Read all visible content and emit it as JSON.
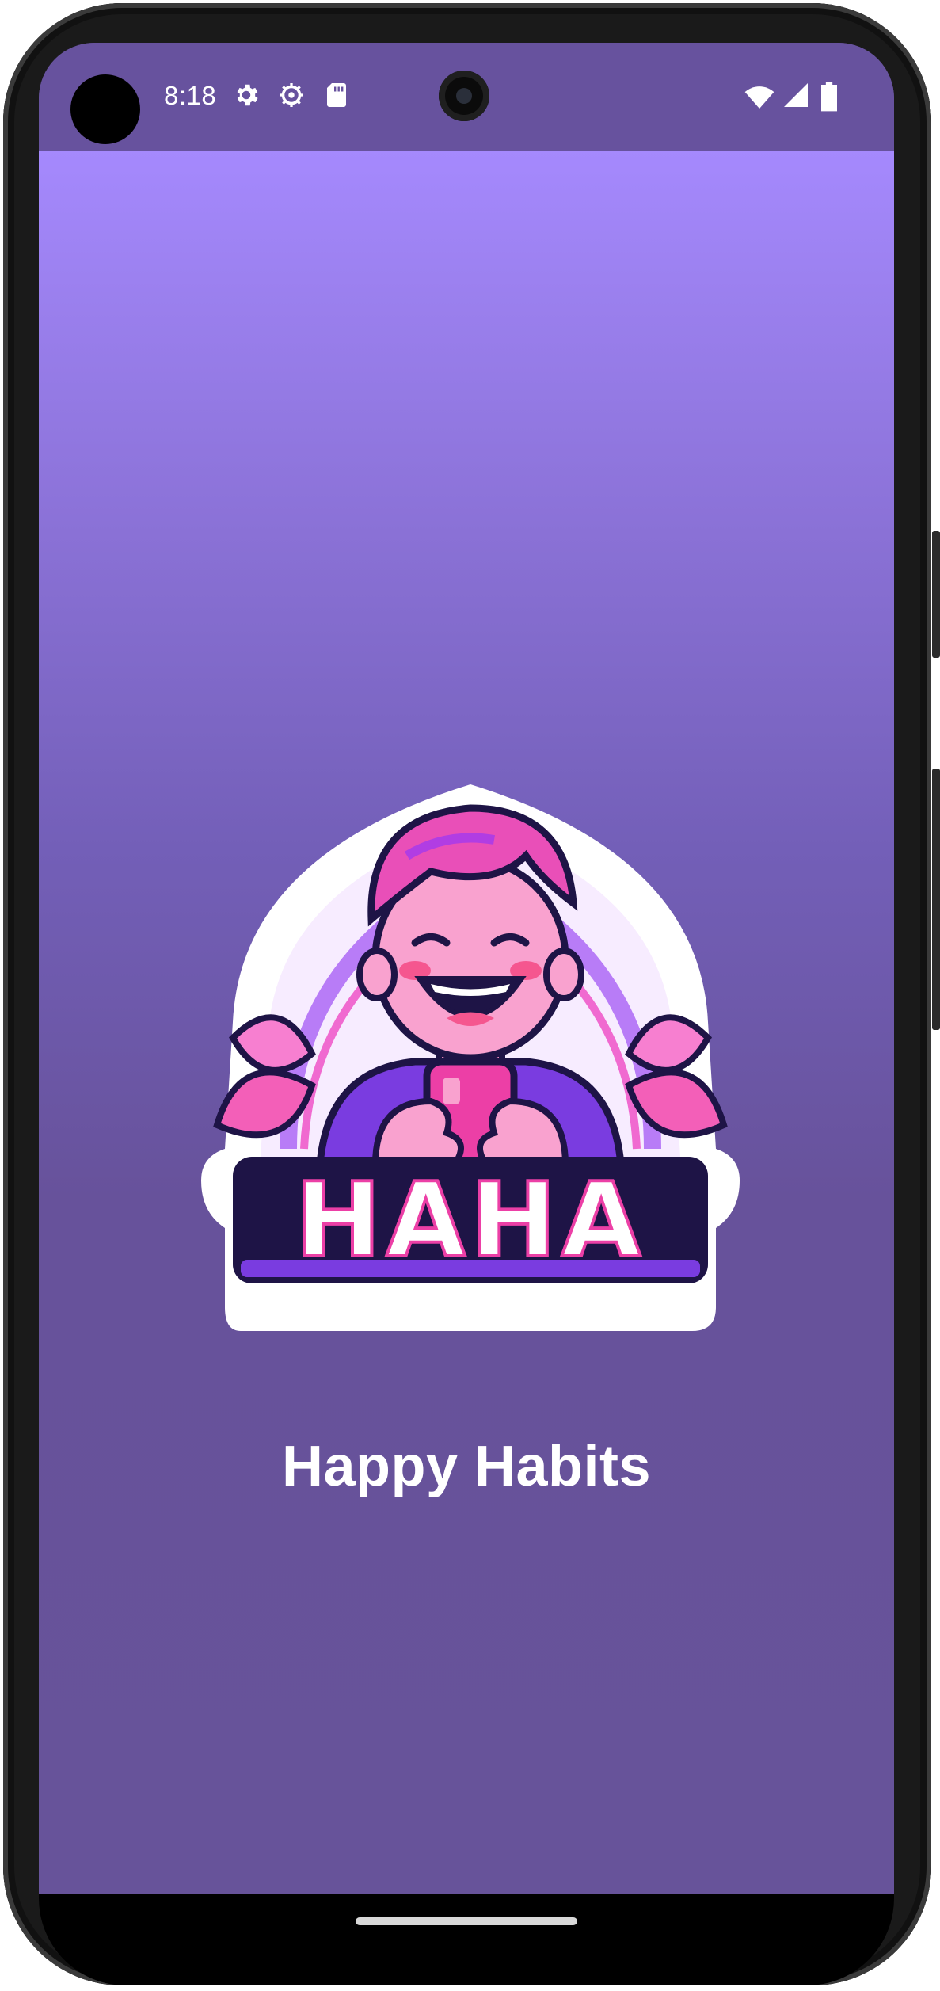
{
  "status_bar": {
    "time": "8:18",
    "left_icons": [
      "gear-icon",
      "debug-icon",
      "sd-card-icon"
    ],
    "right_icons": [
      "wifi-icon",
      "signal-icon",
      "battery-icon"
    ]
  },
  "app": {
    "logo_text": "HAHA",
    "title": "Happy Habits"
  },
  "colors": {
    "status_bar": "#67529e",
    "gradient_top": "#a589fd",
    "gradient_bottom": "#67539a",
    "title": "#ffffff"
  }
}
